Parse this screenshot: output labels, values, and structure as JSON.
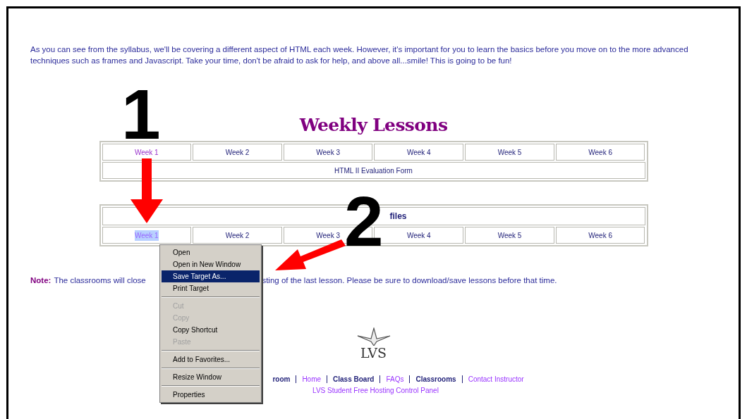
{
  "intro": "As you can see from the syllabus, we'll be covering a different aspect of HTML each week.  However, it's important for you to learn the basics before you move on to the more advanced techniques such as frames and Javascript. Take your time, don't be afraid to ask for help, and above all...smile! This is going to be fun!",
  "lessons": {
    "title": "Weekly Lessons",
    "weeks": [
      {
        "label": "Week 1",
        "visited": true
      },
      {
        "label": "Week 2",
        "visited": false
      },
      {
        "label": "Week 3",
        "visited": false
      },
      {
        "label": "Week 4",
        "visited": false
      },
      {
        "label": "Week 5",
        "visited": false
      },
      {
        "label": "Week 6",
        "visited": false
      }
    ],
    "form_link": {
      "label": "HTML II Evaluation Form",
      "visited": false
    }
  },
  "pdf": {
    "title": "files",
    "weeks": [
      {
        "label": "Week 1",
        "highlighted": true
      },
      {
        "label": "Week 2",
        "highlighted": false
      },
      {
        "label": "Week 3",
        "highlighted": false
      },
      {
        "label": "Week 4",
        "highlighted": false
      },
      {
        "label": "Week 5",
        "highlighted": false
      },
      {
        "label": "Week 6",
        "highlighted": false
      }
    ]
  },
  "note": {
    "label": "Note:",
    "text_left": "The classrooms will close",
    "text_right": "sting of the last lesson. Please be sure to download/save lessons before that time."
  },
  "annotations": [
    "1",
    "2"
  ],
  "context_menu": [
    {
      "kind": "item",
      "label": "Open",
      "disabled": false,
      "selected": false
    },
    {
      "kind": "item",
      "label": "Open in New Window",
      "disabled": false,
      "selected": false
    },
    {
      "kind": "item",
      "label": "Save Target As...",
      "disabled": false,
      "selected": true
    },
    {
      "kind": "item",
      "label": "Print Target",
      "disabled": false,
      "selected": false
    },
    {
      "kind": "separator"
    },
    {
      "kind": "item",
      "label": "Cut",
      "disabled": true,
      "selected": false
    },
    {
      "kind": "item",
      "label": "Copy",
      "disabled": true,
      "selected": false
    },
    {
      "kind": "item",
      "label": "Copy Shortcut",
      "disabled": false,
      "selected": false
    },
    {
      "kind": "item",
      "label": "Paste",
      "disabled": true,
      "selected": false
    },
    {
      "kind": "separator"
    },
    {
      "kind": "item",
      "label": "Add to Favorites...",
      "disabled": false,
      "selected": false
    },
    {
      "kind": "separator"
    },
    {
      "kind": "item",
      "label": "Resize Window",
      "disabled": false,
      "selected": false
    },
    {
      "kind": "separator"
    },
    {
      "kind": "item",
      "label": "Properties",
      "disabled": false,
      "selected": false
    }
  ],
  "logo": {
    "text": "LVS"
  },
  "footer_links": [
    {
      "label": "room",
      "visited": false
    },
    {
      "label": "Home",
      "visited": true
    },
    {
      "label": "Class Board",
      "visited": false
    },
    {
      "label": "FAQs",
      "visited": true
    },
    {
      "label": "Classrooms",
      "visited": false
    },
    {
      "label": "Contact Instructor",
      "visited": true
    }
  ],
  "hosting_link": {
    "label": "LVS Student Free Hosting Control Panel",
    "visited": true
  }
}
